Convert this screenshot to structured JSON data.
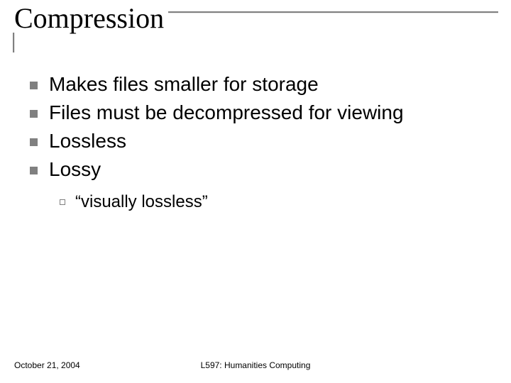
{
  "title": "Compression",
  "bullets": [
    "Makes files smaller for storage",
    "Files must be decompressed for viewing",
    "Lossless",
    "Lossy"
  ],
  "sub_bullets": [
    "“visually lossless”"
  ],
  "footer": {
    "date": "October 21, 2004",
    "center": "L597: Humanities Computing"
  }
}
